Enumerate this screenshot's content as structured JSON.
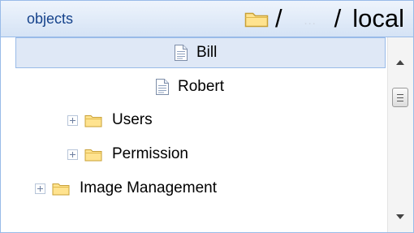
{
  "header": {
    "title": "objects",
    "path": {
      "folder_icon": "folder-icon",
      "separator": "/",
      "ellipsis": "…",
      "segment": "local"
    }
  },
  "tree": {
    "items": [
      {
        "label": "Bill",
        "icon": "file-icon",
        "selected": true
      },
      {
        "label": "Robert",
        "icon": "file-icon",
        "selected": false
      },
      {
        "label": "Users",
        "icon": "folder-icon",
        "expandable": true
      },
      {
        "label": "Permission",
        "icon": "folder-icon",
        "expandable": true
      },
      {
        "label": "Image Management",
        "icon": "folder-icon",
        "expandable": true
      }
    ]
  },
  "scrollbar": {
    "up_icon": "chevron-up-icon",
    "down_icon": "chevron-down-icon",
    "position": 0.12
  },
  "colors": {
    "header_border": "#99bbe8",
    "selection_bg": "#dfe8f6",
    "title_text": "#15428b",
    "folder_fill": "#ffe38f",
    "folder_stroke": "#c8a036"
  }
}
